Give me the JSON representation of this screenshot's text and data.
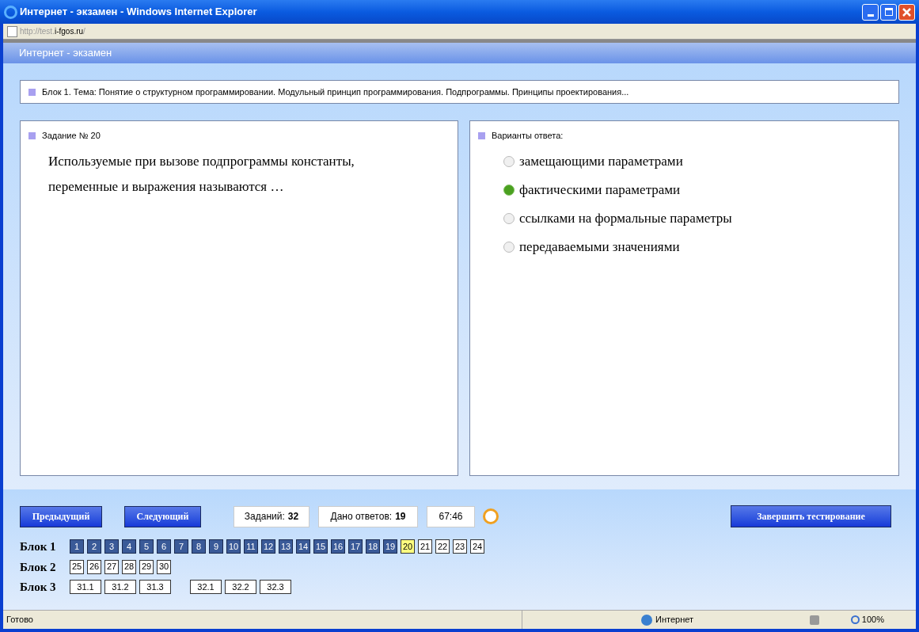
{
  "window": {
    "title": "Интернет - экзамен - Windows Internet Explorer"
  },
  "address": {
    "prefix": "http://test.",
    "host": "i-fgos.ru",
    "suffix": "/"
  },
  "app_header": {
    "title": "Интернет - экзамен"
  },
  "topic": "Блок 1. Тема: Понятие о структурном программировании. Модульный принцип программирования. Подпрограммы. Принципы проектирования...",
  "question": {
    "heading": "Задание № 20",
    "text": "Используемые при вызове подпрограммы константы, переменные и выражения называются …"
  },
  "answers": {
    "heading": "Варианты ответа:",
    "options": [
      {
        "label": "замещающими параметрами",
        "selected": false
      },
      {
        "label": "фактическими параметрами",
        "selected": true
      },
      {
        "label": "ссылками на формальные параметры",
        "selected": false
      },
      {
        "label": "передаваемыми значениями",
        "selected": false
      }
    ]
  },
  "controls": {
    "prev": "Предыдущий",
    "next": "Следующий",
    "tasks_label": "Заданий:",
    "tasks_value": "32",
    "answered_label": "Дано ответов:",
    "answered_value": "19",
    "timer": "67:46",
    "finish": "Завершить тестирование"
  },
  "blocks": [
    {
      "label": "Блок 1",
      "groups": [
        {
          "cells": [
            {
              "label": "1",
              "answered": true,
              "selected": false
            },
            {
              "label": "2",
              "answered": true,
              "selected": false
            },
            {
              "label": "3",
              "answered": true,
              "selected": false
            },
            {
              "label": "4",
              "answered": true,
              "selected": false
            },
            {
              "label": "5",
              "answered": true,
              "selected": false
            },
            {
              "label": "6",
              "answered": true,
              "selected": false
            },
            {
              "label": "7",
              "answered": true,
              "selected": false
            },
            {
              "label": "8",
              "answered": true,
              "selected": false
            },
            {
              "label": "9",
              "answered": true,
              "selected": false
            },
            {
              "label": "10",
              "answered": true,
              "selected": false
            },
            {
              "label": "11",
              "answered": true,
              "selected": false
            },
            {
              "label": "12",
              "answered": true,
              "selected": false
            },
            {
              "label": "13",
              "answered": true,
              "selected": false
            },
            {
              "label": "14",
              "answered": true,
              "selected": false
            },
            {
              "label": "15",
              "answered": true,
              "selected": false
            },
            {
              "label": "16",
              "answered": true,
              "selected": false
            },
            {
              "label": "17",
              "answered": true,
              "selected": false
            },
            {
              "label": "18",
              "answered": true,
              "selected": false
            },
            {
              "label": "19",
              "answered": true,
              "selected": false
            },
            {
              "label": "20",
              "answered": false,
              "selected": true
            },
            {
              "label": "21",
              "answered": false,
              "selected": false
            },
            {
              "label": "22",
              "answered": false,
              "selected": false
            },
            {
              "label": "23",
              "answered": false,
              "selected": false
            },
            {
              "label": "24",
              "answered": false,
              "selected": false
            }
          ]
        }
      ]
    },
    {
      "label": "Блок 2",
      "groups": [
        {
          "cells": [
            {
              "label": "25",
              "answered": false,
              "selected": false
            },
            {
              "label": "26",
              "answered": false,
              "selected": false
            },
            {
              "label": "27",
              "answered": false,
              "selected": false
            },
            {
              "label": "28",
              "answered": false,
              "selected": false
            },
            {
              "label": "29",
              "answered": false,
              "selected": false
            },
            {
              "label": "30",
              "answered": false,
              "selected": false
            }
          ]
        }
      ]
    },
    {
      "label": "Блок 3",
      "groups": [
        {
          "cells": [
            {
              "label": "31.1",
              "answered": false,
              "selected": false
            },
            {
              "label": "31.2",
              "answered": false,
              "selected": false
            },
            {
              "label": "31.3",
              "answered": false,
              "selected": false
            }
          ]
        },
        {
          "cells": [
            {
              "label": "32.1",
              "answered": false,
              "selected": false
            },
            {
              "label": "32.2",
              "answered": false,
              "selected": false
            },
            {
              "label": "32.3",
              "answered": false,
              "selected": false
            }
          ]
        }
      ]
    }
  ],
  "status_bar": {
    "status": "Готово",
    "zone": "Интернет",
    "zoom": "100%"
  }
}
